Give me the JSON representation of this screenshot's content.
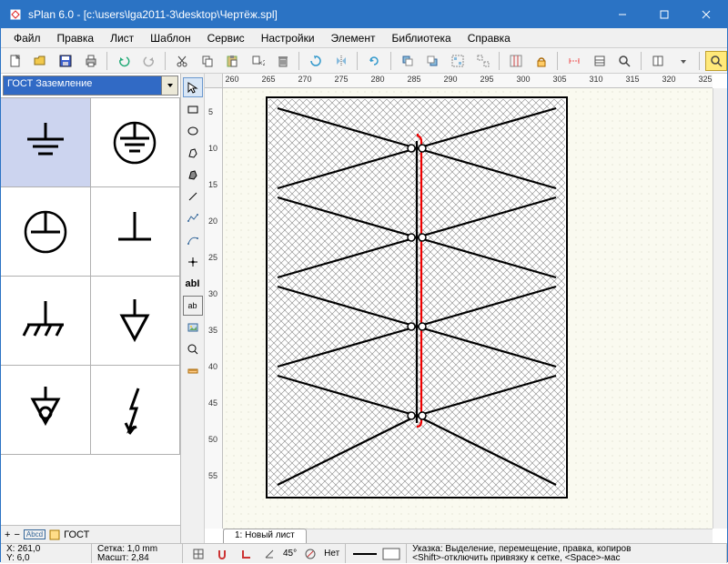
{
  "window": {
    "title": "sPlan 6.0 - [c:\\users\\lga2011-3\\desktop\\Чертёж.spl]"
  },
  "menu": {
    "items": [
      "Файл",
      "Правка",
      "Лист",
      "Шаблон",
      "Сервис",
      "Настройки",
      "Элемент",
      "Библиотека",
      "Справка"
    ]
  },
  "library": {
    "selected": "ГОСТ Заземление",
    "footer_label": "ГОСТ"
  },
  "ruler": {
    "h_ticks": [
      "260",
      "265",
      "270",
      "275",
      "280",
      "285",
      "290",
      "295",
      "300",
      "305",
      "310",
      "315",
      "320",
      "325"
    ],
    "v_ticks": [
      "5",
      "10",
      "15",
      "20",
      "25",
      "30",
      "35",
      "40",
      "45",
      "50",
      "55"
    ]
  },
  "sheet": {
    "tab": "1: Новый лист"
  },
  "status": {
    "coord_x": "X: 261,0",
    "coord_y": "Y: 6,0",
    "grid": "Сетка:  1,0 mm",
    "scale": "Масшт:  2,84",
    "angle": "45°",
    "snap": "Нет",
    "hint": "Указка: Выделение, перемещение, правка, копиров",
    "hint2": "<Shift>-отключить привязку к сетке, <Space>-мас"
  },
  "vtoolbar": {
    "text1": "abI",
    "text2": "ab"
  }
}
